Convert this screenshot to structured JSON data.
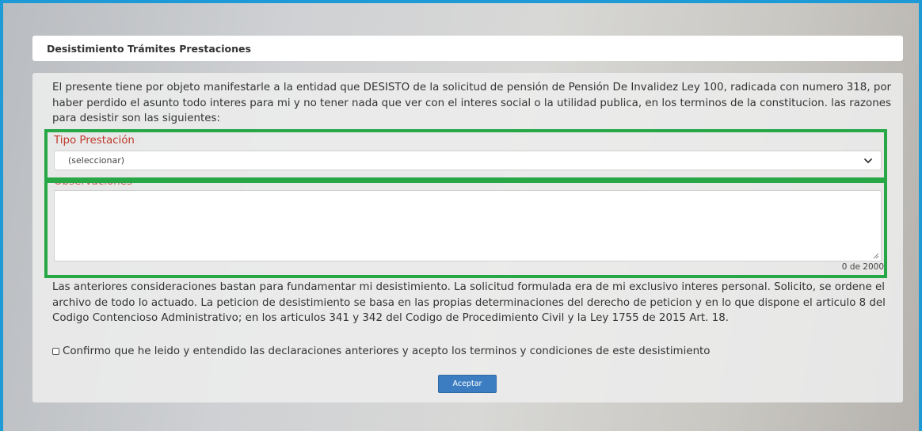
{
  "header": {
    "title": "Desistimiento Trámites Prestaciones"
  },
  "intro_text": "El presente tiene por objeto manifestarle a la entidad que DESISTO de la solicitud de pensión de Pensión De Invalidez Ley 100, radicada con numero 318, por haber perdido el asunto todo interes para mi y no tener nada que ver con el interes social o la utilidad publica, en los terminos de la constitucion. las razones para desistir son las siguientes:",
  "form": {
    "tipo_prestacion": {
      "label": "Tipo Prestación",
      "selected": "(seleccionar)"
    },
    "observaciones": {
      "label": "Observaciones",
      "value": "",
      "counter": "0 de 2000"
    }
  },
  "closing_text": "Las anteriores consideraciones bastan para fundamentar mi desistimiento. La solicitud formulada era de mi exclusivo interes personal. Solicito, se ordene el archivo de todo lo actuado. La peticion de desistimiento se basa en las propias determinaciones del derecho de peticion y en lo que dispone el articulo 8 del Codigo Contencioso Administrativo; en los articulos 341 y 342 del Codigo de Procedimiento Civil y la Ley 1755 de 2015 Art. 18.",
  "confirm": {
    "label": "Confirmo que he leido y entendido las declaraciones anteriores y acepto los terminos y condiciones de este desistimiento",
    "checked": false
  },
  "actions": {
    "accept_label": "Aceptar"
  },
  "colors": {
    "frame_border": "#1e9bd7",
    "highlight_box": "#27a745",
    "field_label": "#c0392b",
    "primary_button": "#3b7dc0"
  },
  "icons": {
    "select_arrow": "chevron-down-icon",
    "textarea_resize": "resize-grip-icon"
  }
}
